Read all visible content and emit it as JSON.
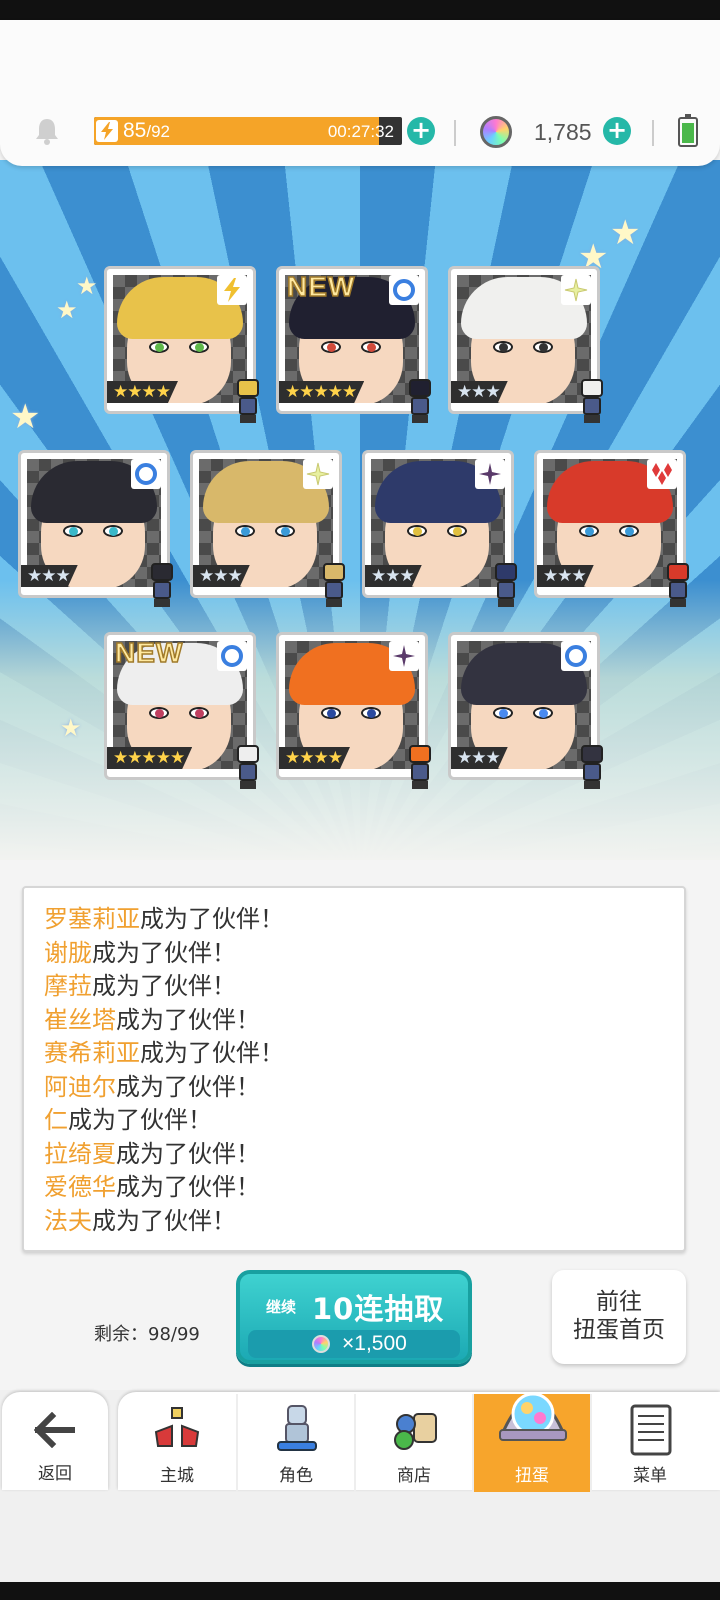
{
  "status": {
    "stamina_current": "85",
    "stamina_max": "/92",
    "stamina_fraction": 0.924,
    "stamina_timer": "00:27:32",
    "gem_count": "1,785"
  },
  "cards": [
    {
      "stars": "★★★★",
      "attr": "bolt",
      "is_new": false,
      "hair": "#e8c24a",
      "eye": "#5fb84a"
    },
    {
      "stars": "★★★★★",
      "attr": "ring",
      "is_new": true,
      "hair": "#202030",
      "eye": "#d24a3a"
    },
    {
      "stars": "★★★",
      "attr": "sparkle",
      "is_new": false,
      "hair": "#f0f0ee",
      "eye": "#333"
    },
    {
      "stars": "★★★",
      "attr": "ring",
      "is_new": false,
      "hair": "#2a2a32",
      "eye": "#3ab8c8"
    },
    {
      "stars": "★★★",
      "attr": "sparkle",
      "is_new": false,
      "hair": "#d8b86a",
      "eye": "#3a9ad8"
    },
    {
      "stars": "★★★",
      "attr": "dark",
      "is_new": false,
      "hair": "#2e3a6a",
      "eye": "#e0c040"
    },
    {
      "stars": "★★★",
      "attr": "diamond",
      "is_new": false,
      "hair": "#d83a2a",
      "eye": "#3a9ad8"
    },
    {
      "stars": "★★★★★",
      "attr": "ring",
      "is_new": true,
      "hair": "#eeeeee",
      "eye": "#c04060"
    },
    {
      "stars": "★★★★",
      "attr": "dark",
      "is_new": false,
      "hair": "#f07020",
      "eye": "#2a4aa0"
    },
    {
      "stars": "★★★",
      "attr": "ring",
      "is_new": false,
      "hair": "#333340",
      "eye": "#4a8af0"
    }
  ],
  "new_label": "NEW",
  "log": {
    "suffix": "成为了伙伴！",
    "names": [
      "罗塞莉亚",
      "谢胧",
      "摩菈",
      "崔丝塔",
      "赛希莉亚",
      "阿迪尔",
      "仁",
      "拉绮夏",
      "爱德华",
      "法夫"
    ]
  },
  "pull": {
    "remaining": "剩余：98/99",
    "continue_label": "继续",
    "main_label": "10连抽取",
    "cost": "×1,500"
  },
  "home_button": {
    "line1": "前往",
    "line2": "扭蛋首页"
  },
  "nav": {
    "back": "返回",
    "items": [
      "主城",
      "角色",
      "商店",
      "扭蛋",
      "菜单"
    ],
    "active_index": 3
  }
}
